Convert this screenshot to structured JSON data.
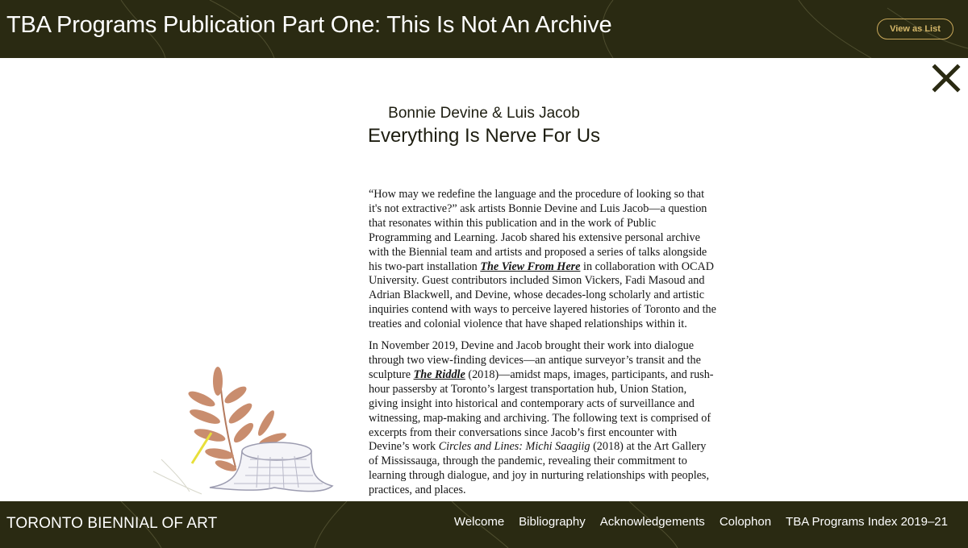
{
  "header": {
    "title": "TBA Programs Publication Part One: This Is Not An Archive",
    "view_list_label": "View as List"
  },
  "article": {
    "authors": "Bonnie Devine & Luis Jacob",
    "title": "Everything Is Nerve For Us",
    "p1_a": "“How may we redefine the language and the procedure of looking so that it's not extractive?” ask artists Bonnie Devine and Luis Jacob—a question that resonates within this publication and in the work of Public Programming and Learning. Jacob shared his extensive personal archive with the Biennial team and artists and proposed a series of talks alongside his two-part installation ",
    "p1_link": "The View From Here",
    "p1_b": " in collaboration with OCAD University. Guest contributors included Simon Vickers, Fadi Masoud and Adrian Blackwell, and Devine, whose decades-long scholarly and artistic inquiries contend with ways to perceive layered histories of Toronto and the treaties and colonial violence that have shaped relationships within it.",
    "p2_a": "In November 2019, Devine and Jacob brought their work into dialogue through two view-finding devices—an antique surveyor’s transit and the sculpture ",
    "p2_link": "The Riddle",
    "p2_b": " (2018)—amidst maps, images, participants, and rush-hour passersby at Toronto’s largest transportation hub, Union Station, giving insight into historical and contemporary acts of surveillance and witnessing, map-making and archiving. The following text is comprised of excerpts from their conversations since Jacob’s first encounter with Devine’s work ",
    "p2_italic": "Circles and Lines: Michi Saagiig",
    "p2_c": " (2018) at the Art Gallery of Mississauga, through the pandemic, revealing their commitment to learning through dialogue, and joy in nurturing relationships with peoples, practices, and places."
  },
  "footer": {
    "logo": "TORONTO BIENNIAL OF ART",
    "nav": [
      "Welcome",
      "Bibliography",
      "Acknowledgements",
      "Colophon",
      "TBA Programs Index 2019–21"
    ]
  },
  "colors": {
    "bar_background": "#2a2a12",
    "button_accent": "#c9a85a",
    "leaf": "#c98d6e"
  },
  "icons": [
    "close-icon",
    "leaf-stump-illustration"
  ]
}
